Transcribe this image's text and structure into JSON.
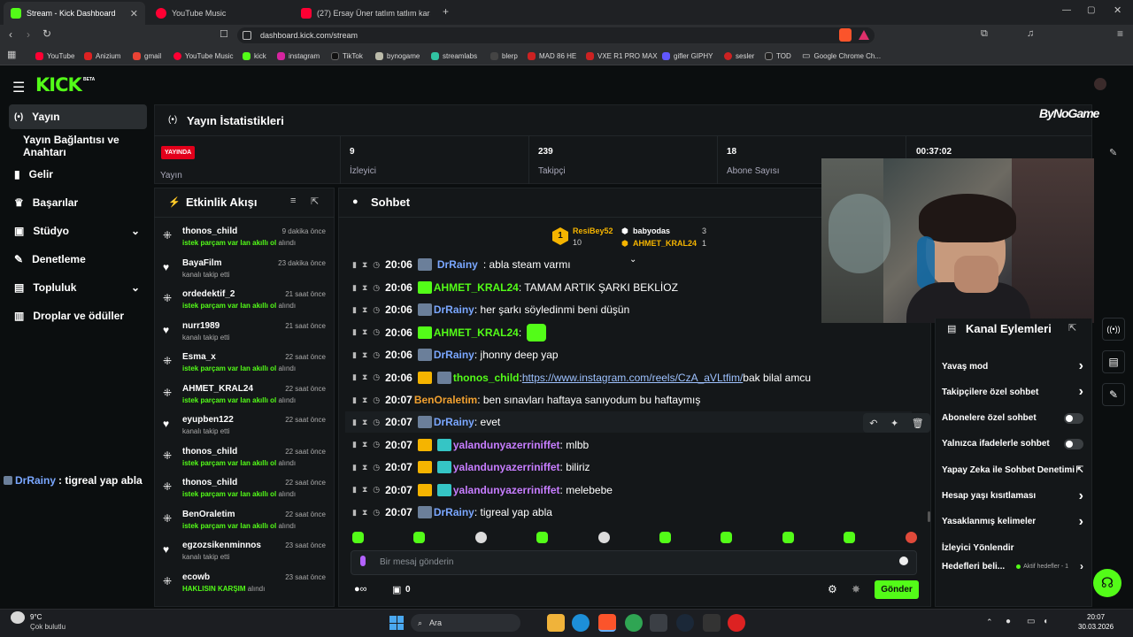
{
  "browser": {
    "tabs": [
      {
        "title": "Stream - Kick Dashboard",
        "color": "#53fc18"
      },
      {
        "title": "YouTube Music",
        "color": "#ff0033"
      },
      {
        "title": "(27) Ersay Üner tatlım tatlım karaoke",
        "color": "#ff0033"
      }
    ],
    "url": "dashboard.kick.com/stream",
    "bookmarks": [
      "YouTube",
      "Anizium",
      "gmail",
      "YouTube Music",
      "kick",
      "instagram",
      "TikTok",
      "bynogame",
      "streamlabs",
      "blerp",
      "MAD 86 HE",
      "VXE R1 PRO MAX",
      "gifler GIPHY",
      "sesler",
      "TOD",
      "Google Chrome Ch..."
    ]
  },
  "app": {
    "logo": "KICK",
    "logo_beta": "BETA",
    "accent": "#53fc18"
  },
  "sidebar": {
    "items": [
      {
        "label": "Yayın",
        "icon": "broadcast-icon"
      },
      {
        "label": "Yayın Bağlantısı ve Anahtarı",
        "icon": ""
      },
      {
        "label": "Gelir",
        "icon": "chart-icon"
      },
      {
        "label": "Başarılar",
        "icon": "trophy-icon"
      },
      {
        "label": "Stüdyo",
        "icon": "studio-icon"
      },
      {
        "label": "Denetleme",
        "icon": "wrench-icon"
      },
      {
        "label": "Topluluk",
        "icon": "community-icon"
      },
      {
        "label": "Droplar ve ödüller",
        "icon": "drops-icon"
      }
    ],
    "overlay_chat_user": "DrRainy",
    "overlay_chat_text": ": tigreal yap abla"
  },
  "stats": {
    "title": "Yayın İstatistikleri",
    "live_badge": "YAYINDA",
    "live_label": "Yayın",
    "viewers": {
      "value": "9",
      "label": "İzleyici"
    },
    "followers": {
      "value": "239",
      "label": "Takipçi"
    },
    "subs": {
      "value": "18",
      "label": "Abone Sayısı"
    },
    "uptime": "00:37:02",
    "brand": "ByNoGame"
  },
  "activity": {
    "title": "Etkinlik Akışı",
    "events": [
      {
        "user": "thonos_child",
        "time": "9 dakika önce",
        "pre": "",
        "hl": "istek parçam var lan akıllı ol",
        "post": " alındı",
        "type": "reward"
      },
      {
        "user": "BayaFilm",
        "time": "23 dakika önce",
        "pre": "kanalı takip etti",
        "hl": "",
        "post": "",
        "type": "follow"
      },
      {
        "user": "ordedektif_2",
        "time": "21 saat önce",
        "pre": "",
        "hl": "istek parçam var lan akıllı ol",
        "post": " alındı",
        "type": "reward"
      },
      {
        "user": "nurr1989",
        "time": "21 saat önce",
        "pre": "kanalı takip etti",
        "hl": "",
        "post": "",
        "type": "follow"
      },
      {
        "user": "Esma_x",
        "time": "22 saat önce",
        "pre": "",
        "hl": "istek parçam var lan akıllı ol",
        "post": " alındı",
        "type": "reward"
      },
      {
        "user": "AHMET_KRAL24",
        "time": "22 saat önce",
        "pre": "",
        "hl": "istek parçam var lan akıllı ol",
        "post": " alındı",
        "type": "reward"
      },
      {
        "user": "eyupben122",
        "time": "22 saat önce",
        "pre": "kanalı takip etti",
        "hl": "",
        "post": "",
        "type": "follow"
      },
      {
        "user": "thonos_child",
        "time": "22 saat önce",
        "pre": "",
        "hl": "istek parçam var lan akıllı ol",
        "post": " alındı",
        "type": "reward"
      },
      {
        "user": "thonos_child",
        "time": "22 saat önce",
        "pre": "",
        "hl": "istek parçam var lan akıllı ol",
        "post": " alındı",
        "type": "reward"
      },
      {
        "user": "BenOraletim",
        "time": "22 saat önce",
        "pre": "",
        "hl": "istek parçam var lan akıllı ol",
        "post": " alındı",
        "type": "reward"
      },
      {
        "user": "egzozsikenminnos",
        "time": "23 saat önce",
        "pre": "kanalı takip etti",
        "hl": "",
        "post": "",
        "type": "follow"
      },
      {
        "user": "ecowb",
        "time": "23 saat önce",
        "pre": "",
        "hl": "HAKLISIN KARŞIM",
        "post": " alındı",
        "type": "reward"
      }
    ]
  },
  "chat": {
    "title": "Sohbet",
    "leaders": [
      {
        "name": "ResiBey52",
        "count": "10",
        "color": "#f5b400"
      },
      {
        "name": "babyodas",
        "count": "3",
        "color": "#ffffff"
      },
      {
        "name": "AHMET_KRAL24",
        "count": "1",
        "color": "#f5b400"
      }
    ],
    "leader_rank": "1",
    "partial_msg": {
      "time": "20:06",
      "user": "DrRainy",
      "text": ": abla steam varmı"
    },
    "messages": [
      {
        "time": "20:06",
        "user": "AHMET_KRAL24",
        "color": "#53fc18",
        "text": ": TAMAM ARTIK ŞARKI BEKLİOZ",
        "link": "",
        "after": "",
        "avatar": "green",
        "emote": false
      },
      {
        "time": "20:06",
        "user": "DrRainy",
        "color": "#7aa7ff",
        "text": ": her şarkı söyledinmi beni düşün",
        "link": "",
        "after": "",
        "avatar": "photo",
        "emote": false
      },
      {
        "time": "20:06",
        "user": "AHMET_KRAL24",
        "color": "#53fc18",
        "text": ":",
        "link": "",
        "after": "",
        "avatar": "green",
        "emote": true
      },
      {
        "time": "20:06",
        "user": "DrRainy",
        "color": "#7aa7ff",
        "text": ": jhonny deep yap",
        "link": "",
        "after": "",
        "avatar": "photo",
        "emote": false
      },
      {
        "time": "20:06",
        "user": "thonos_child",
        "color": "#53fc18",
        "text": ": ",
        "link": "https://www.instagram.com/reels/CzA_aVLtfim/",
        "after": " bak bilal amcu",
        "avatar": "crown",
        "emote": false
      },
      {
        "time": "20:07",
        "user": "BenOraletim",
        "color": "#f0a030",
        "text": ": ben sınavları haftaya sanıyodum bu haftaymış",
        "link": "",
        "after": "",
        "avatar": "none",
        "emote": false
      },
      {
        "time": "20:07",
        "user": "DrRainy",
        "color": "#7aa7ff",
        "text": ": evet",
        "link": "",
        "after": "",
        "avatar": "photo",
        "emote": false
      },
      {
        "time": "20:07",
        "user": "yalandunyazerriniffet",
        "color": "#c77dff",
        "text": ": mlbb",
        "link": "",
        "after": "",
        "avatar": "crown",
        "emote": false
      },
      {
        "time": "20:07",
        "user": "yalandunyazerriniffet",
        "color": "#c77dff",
        "text": ": biliriz",
        "link": "",
        "after": "",
        "avatar": "crown",
        "emote": false
      },
      {
        "time": "20:07",
        "user": "yalandunyazerriniffet",
        "color": "#c77dff",
        "text": ": melebebe",
        "link": "",
        "after": "",
        "avatar": "crown",
        "emote": false
      },
      {
        "time": "20:07",
        "user": "DrRainy",
        "color": "#7aa7ff",
        "text": ": tigreal yap abla",
        "link": "",
        "after": "",
        "avatar": "photo",
        "emote": false
      }
    ],
    "input_placeholder": "Bir mesaj gönderin",
    "points_count": "0",
    "send_label": "Gönder"
  },
  "actions": {
    "title": "Kanal Eylemleri",
    "items": [
      {
        "label": "Yavaş mod",
        "control": "arrow"
      },
      {
        "label": "Takipçilere özel sohbet",
        "control": "arrow"
      },
      {
        "label": "Abonelere özel sohbet",
        "control": "toggle"
      },
      {
        "label": "Yalnızca ifadelerle sohbet",
        "control": "toggle"
      },
      {
        "label": "Yapay Zeka ile Sohbet Denetimi",
        "control": "external"
      },
      {
        "label": "Hesap yaşı kısıtlaması",
        "control": "arrow"
      },
      {
        "label": "Yasaklanmış kelimeler",
        "control": "arrow"
      },
      {
        "label": "İzleyici Yönlendir",
        "control": "none"
      }
    ],
    "goals_label": "Hedefleri beli...",
    "goals_status": "Aktif hedefler - 1"
  },
  "taskbar": {
    "weather_temp": "9°C",
    "weather_desc": "Çok bulutlu",
    "search": "Ara",
    "time": "20:07",
    "date": "30.03.2026"
  }
}
